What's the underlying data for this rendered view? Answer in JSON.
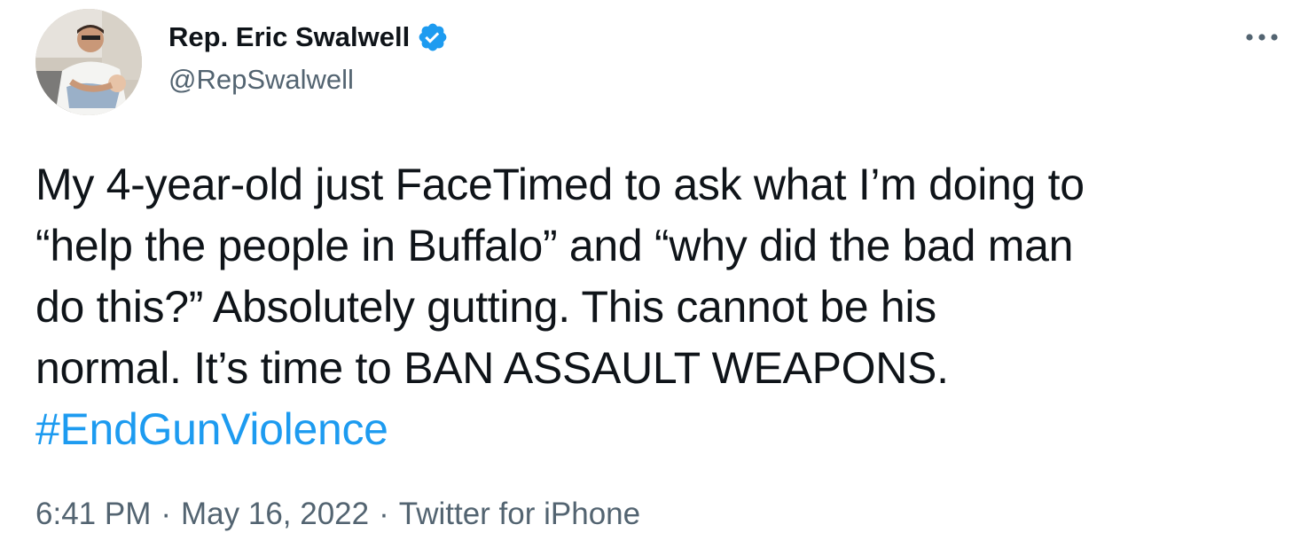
{
  "author": {
    "display_name": "Rep. Eric Swalwell",
    "handle": "@RepSwalwell",
    "verified": true
  },
  "tweet": {
    "text_lines": [
      "My 4-year-old just FaceTimed to ask what I’m doing to",
      "“help the people in Buffalo” and “why did the bad man",
      "do this?” Absolutely gutting. This cannot be his",
      "normal. It’s time to BAN ASSAULT WEAPONS."
    ],
    "hashtag": "#EndGunViolence"
  },
  "meta": {
    "time": "6:41 PM",
    "separator": "·",
    "date": "May 16, 2022",
    "source": "Twitter for iPhone"
  },
  "icons": {
    "verified": "verified-badge-icon",
    "more": "more-options-icon"
  },
  "colors": {
    "text": "#0f1419",
    "secondary": "#536471",
    "accent": "#1d9bf0"
  }
}
